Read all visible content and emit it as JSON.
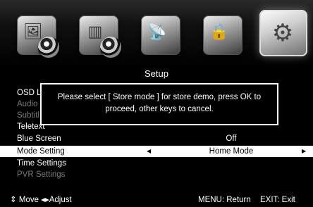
{
  "menu_icons": [
    {
      "name": "picture-icon",
      "glyph": "🖼"
    },
    {
      "name": "sound-icon",
      "glyph": "▥"
    },
    {
      "name": "channel-icon",
      "glyph": "📡"
    },
    {
      "name": "lock-icon",
      "glyph": "🔒"
    },
    {
      "name": "setup-gear-icon",
      "glyph": "⚙",
      "active": true
    }
  ],
  "title": "Setup",
  "rows": [
    {
      "label": "OSD L",
      "value": "",
      "state": "normal"
    },
    {
      "label": "Audio",
      "value": "",
      "state": "dim"
    },
    {
      "label": "Subtitl",
      "value": "",
      "state": "dim"
    },
    {
      "label": "Teletext",
      "value": "",
      "state": "normal"
    },
    {
      "label": "Blue Screen",
      "value": "Off",
      "state": "normal"
    },
    {
      "label": "Mode Setting",
      "value": "Home Mode",
      "state": "selected"
    },
    {
      "label": "Time Settings",
      "value": "",
      "state": "normal"
    },
    {
      "label": "PVR Settings",
      "value": "",
      "state": "dim"
    }
  ],
  "dialog": {
    "line1": "Please select [ Store mode ] for store demo, press OK to",
    "line2": "proceed, other keys to cancel."
  },
  "footer": {
    "move": "Move",
    "adjust": "Adjust",
    "menu": "MENU: Return",
    "exit": "EXIT: Exit"
  }
}
